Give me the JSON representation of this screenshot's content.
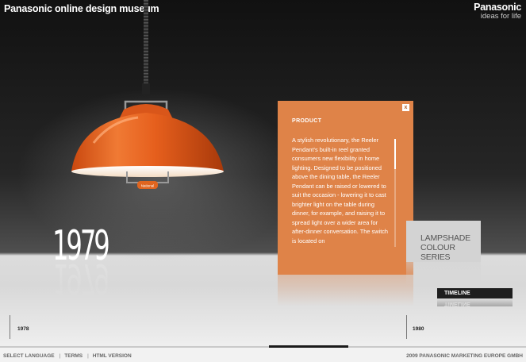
{
  "header": {
    "site_title": "Panasonic online design museum",
    "logo_brand": "Panasonic",
    "logo_tagline": "ideas for life"
  },
  "hero": {
    "year": "1979",
    "lamp_colour": "#e25f1c"
  },
  "product_panel": {
    "close_label": "x",
    "heading": "PRODUCT",
    "text": "A stylish revolutionary, the Reeler Pendant's built-in reel granted consumers new flexibility in home lighting. Designed to be positioned above the dining table, the Reeler Pendant can be raised or lowered to suit the occasion - lowering it to cast brighter light on the table during dinner, for example, and raising it to spread light over a wider area for after-dinner conversation. The switch is located on",
    "bg_color": "#df8348"
  },
  "colour_series": {
    "line1": "LAMPSHADE",
    "line2": "COLOUR SERIES"
  },
  "timeline": {
    "tab_label": "TIMELINE",
    "left_year": "1978",
    "right_year": "1980"
  },
  "footer": {
    "links": [
      "SELECT LANGUAGE",
      "TERMS",
      "HTML VERSION"
    ],
    "copyright": "2009 PANASONIC MARKETING EUROPE GMBH"
  }
}
